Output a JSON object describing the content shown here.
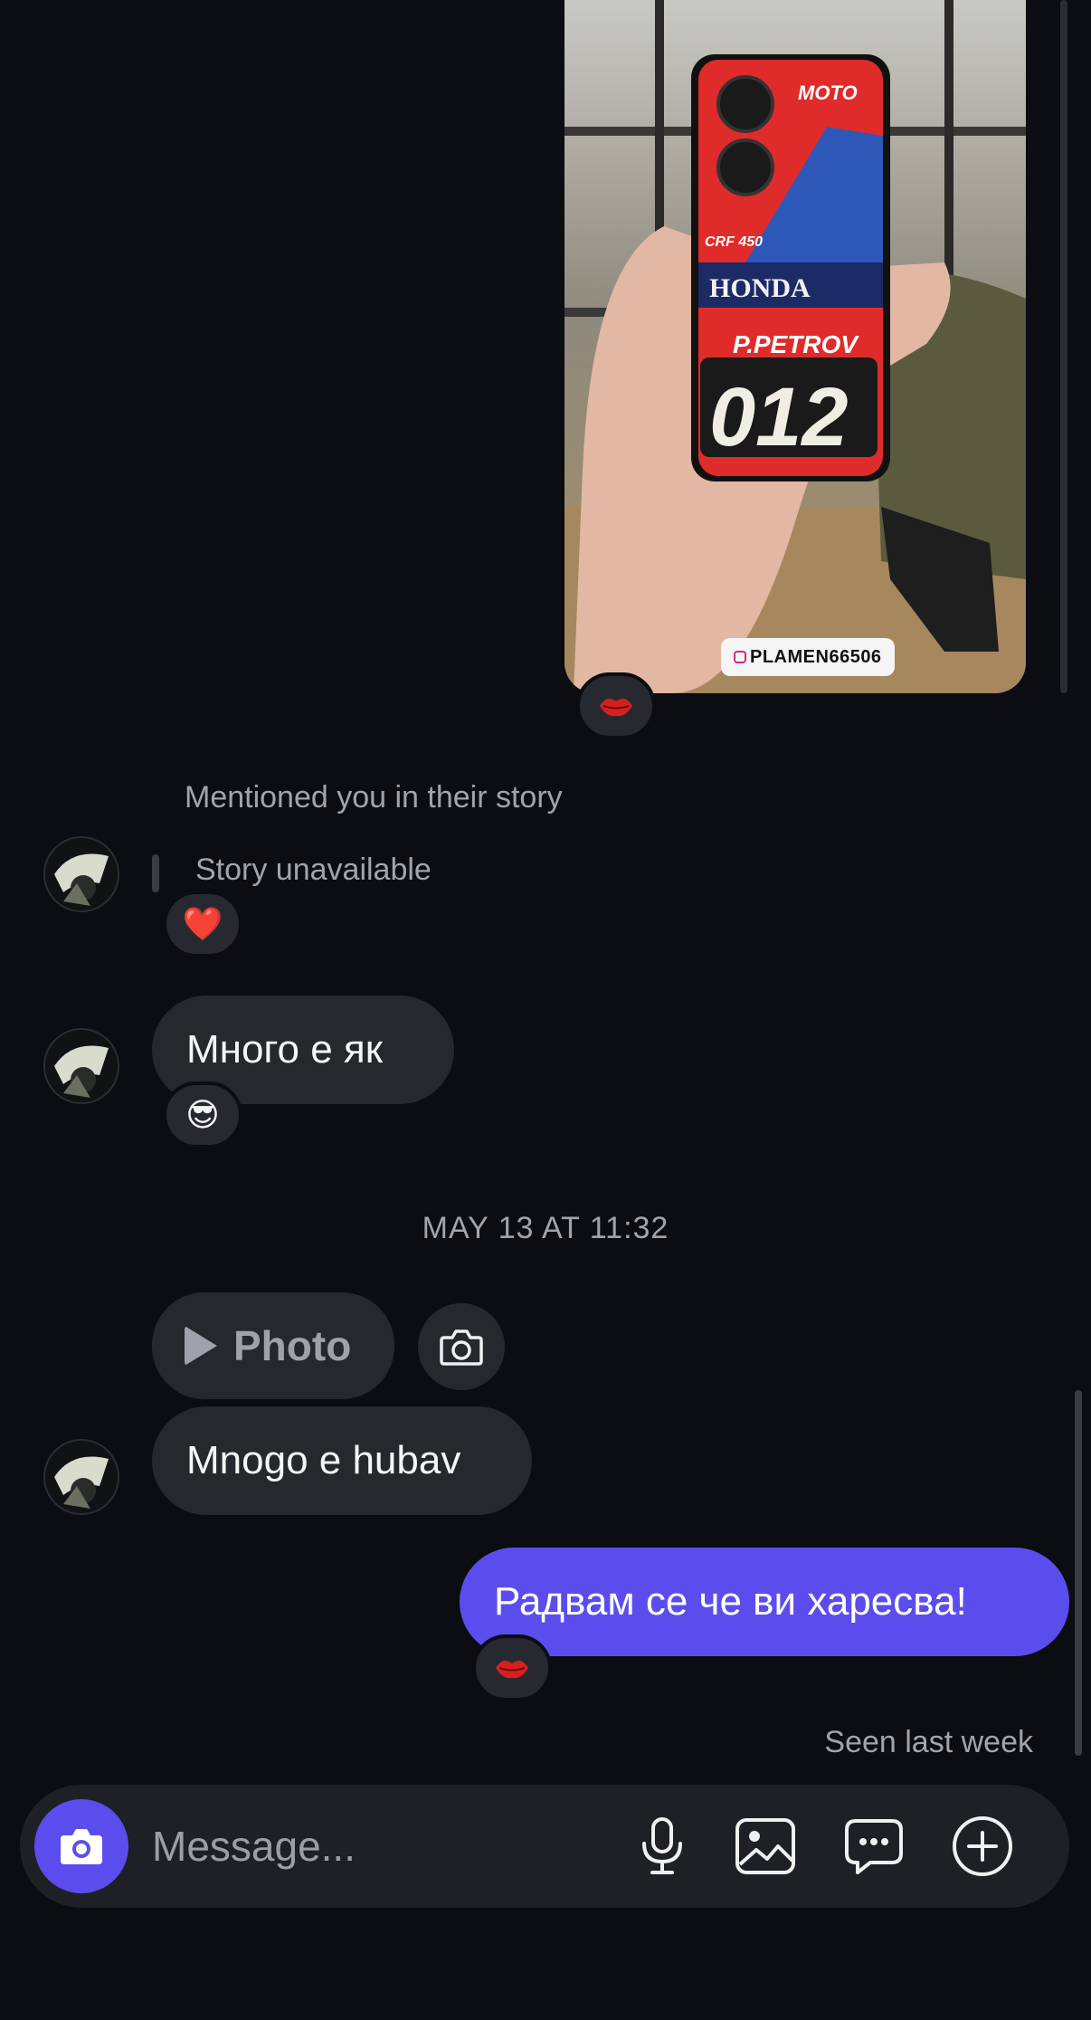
{
  "story_post": {
    "tag_text": "PLAMEN66506",
    "reaction": "lips-icon"
  },
  "story_mention": {
    "label": "Mentioned you in their story",
    "unavailable": "Story unavailable",
    "reaction": "❤️"
  },
  "messages": [
    {
      "text": "Много е як",
      "reaction": "😎"
    }
  ],
  "date_separator": "MAY 13 AT 11:32",
  "photo_message": {
    "label": "Photo"
  },
  "incoming_2": {
    "text": "Mnogo e hubav"
  },
  "outgoing": {
    "text": "Радвам се че ви харесва!",
    "reaction": "lips-icon"
  },
  "seen_status": "Seen last week",
  "composer": {
    "placeholder": "Message..."
  },
  "colors": {
    "accent": "#5b4ded",
    "bubble_in": "#25282d",
    "background": "#0b0d12"
  }
}
